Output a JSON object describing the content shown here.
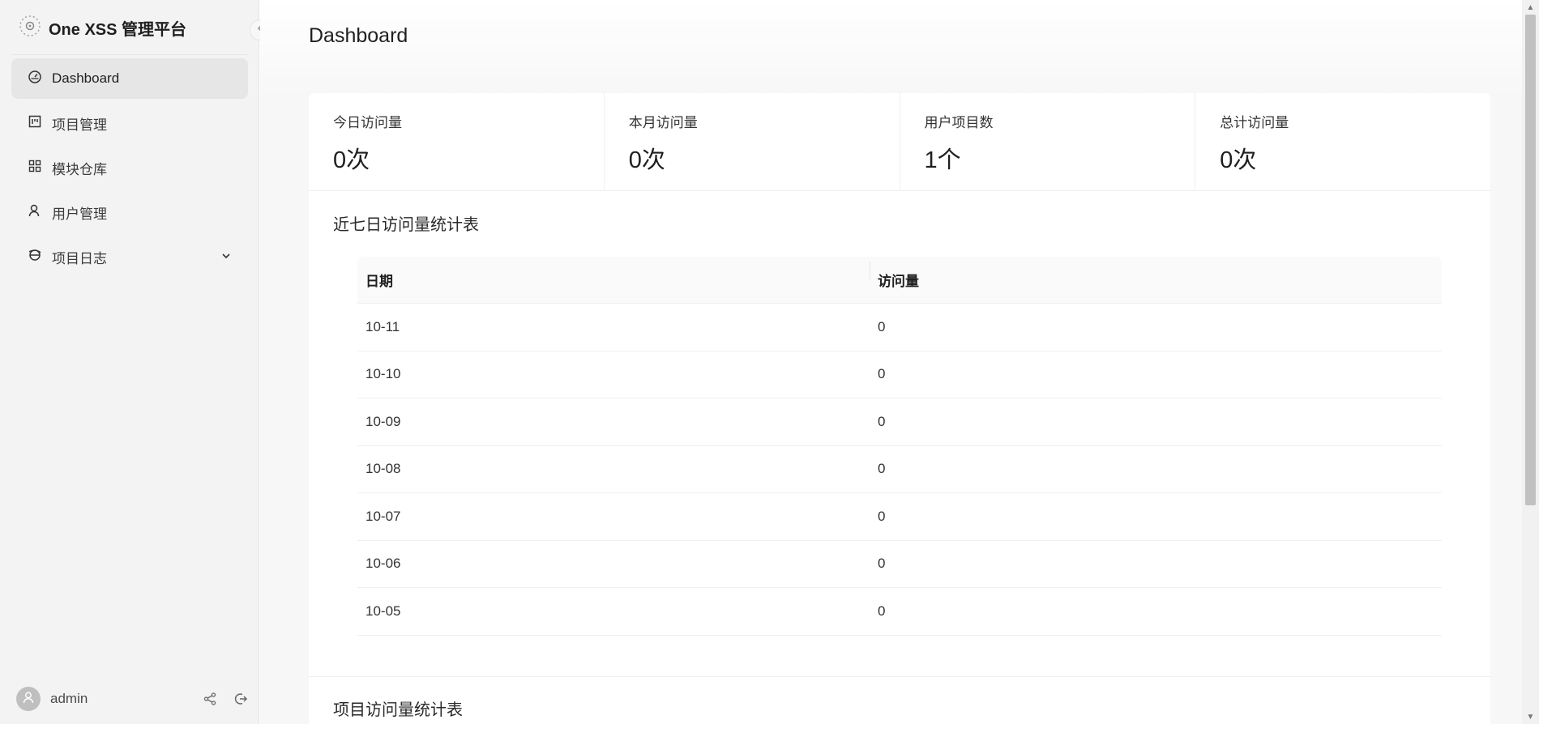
{
  "app": {
    "title": "One XSS 管理平台"
  },
  "sidebar": {
    "items": [
      {
        "label": "Dashboard",
        "icon": "dashboard-icon"
      },
      {
        "label": "项目管理",
        "icon": "project-icon"
      },
      {
        "label": "模块仓库",
        "icon": "module-icon"
      },
      {
        "label": "用户管理",
        "icon": "user-icon"
      },
      {
        "label": "项目日志",
        "icon": "log-icon"
      }
    ],
    "user": {
      "name": "admin"
    }
  },
  "main": {
    "title": "Dashboard",
    "stats": [
      {
        "label": "今日访问量",
        "value": "0次"
      },
      {
        "label": "本月访问量",
        "value": "0次"
      },
      {
        "label": "用户项目数",
        "value": "1个"
      },
      {
        "label": "总计访问量",
        "value": "0次"
      }
    ],
    "weekly_section_title": "近七日访问量统计表",
    "table": {
      "headers": [
        "日期",
        "访问量"
      ],
      "rows": [
        [
          "10-11",
          "0"
        ],
        [
          "10-10",
          "0"
        ],
        [
          "10-09",
          "0"
        ],
        [
          "10-08",
          "0"
        ],
        [
          "10-07",
          "0"
        ],
        [
          "10-06",
          "0"
        ],
        [
          "10-05",
          "0"
        ]
      ]
    },
    "project_section_title": "项目访问量统计表"
  },
  "colors": {
    "sidebar_bg": "#f3f3f3",
    "active_item_bg": "#e6e6e6",
    "card_bg": "#ffffff",
    "page_bg": "#f7f7f7"
  }
}
